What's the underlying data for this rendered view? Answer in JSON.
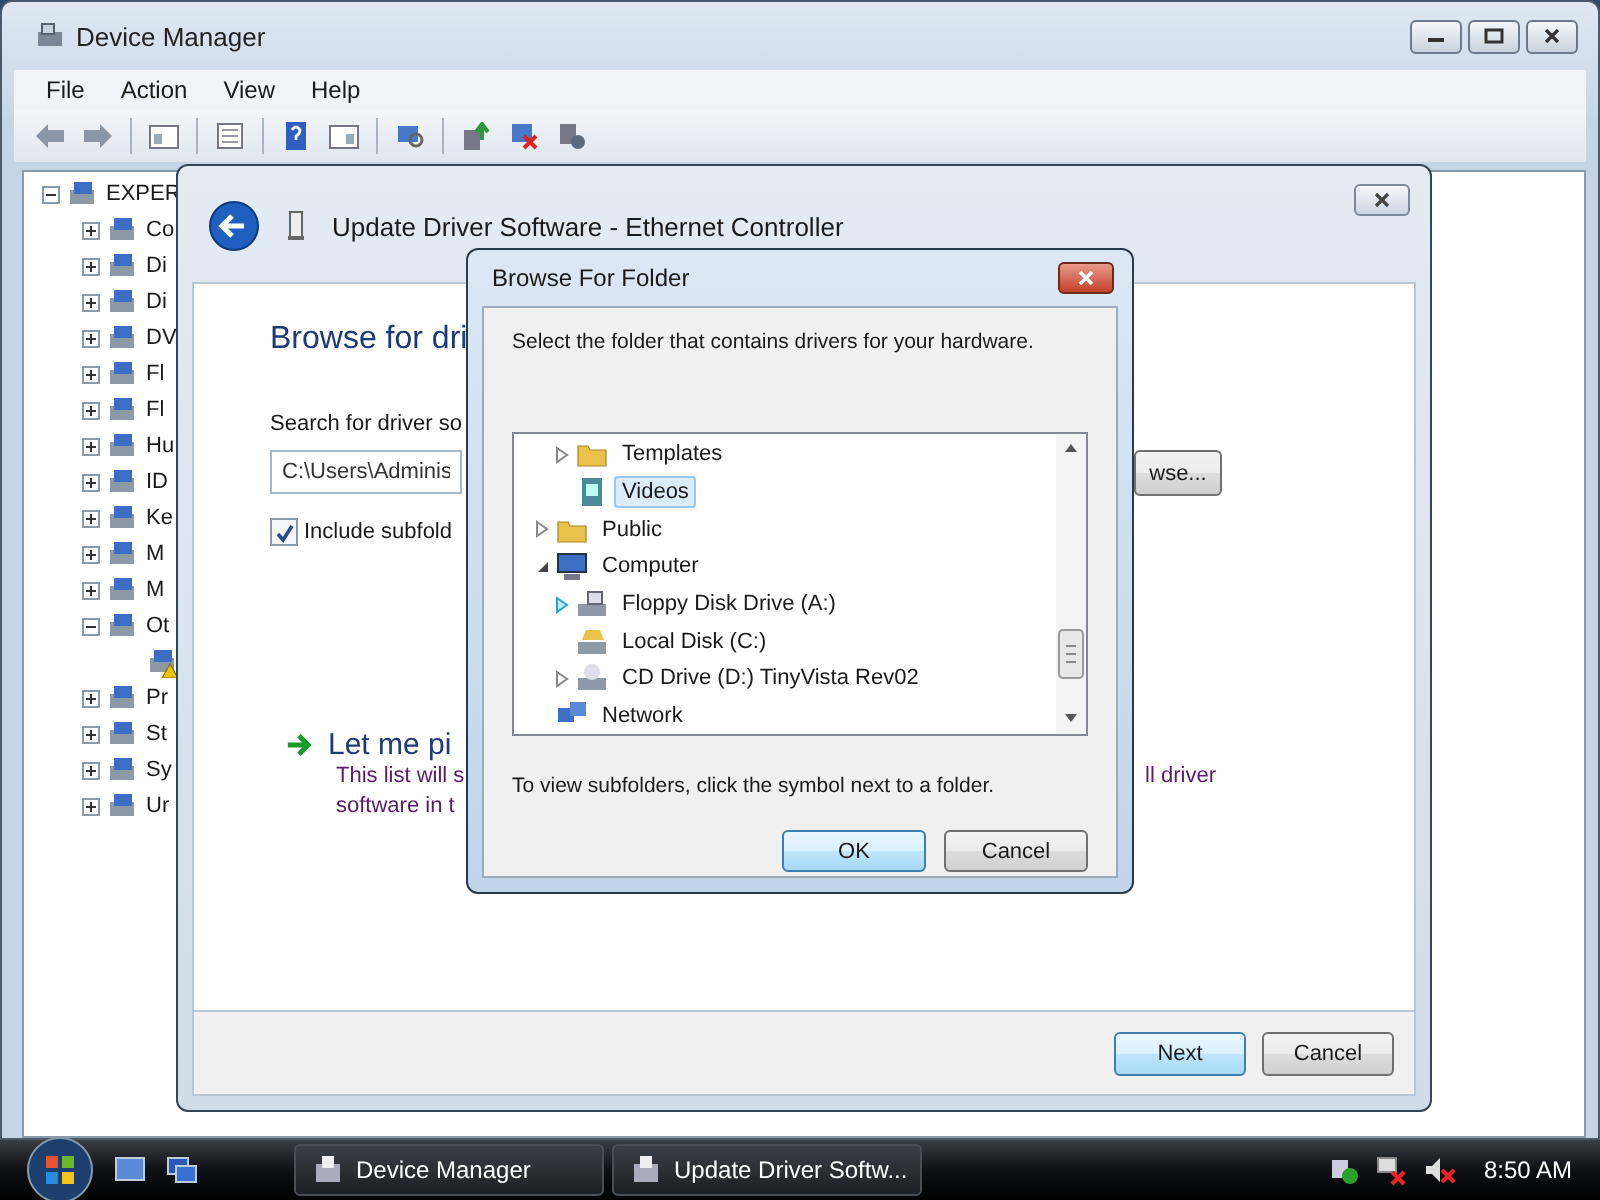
{
  "device_manager": {
    "title": "Device Manager",
    "menu": [
      "File",
      "Action",
      "View",
      "Help"
    ],
    "tree": {
      "label": "EXPER",
      "expanded": true,
      "children": [
        {
          "label": "Co",
          "expanded": false
        },
        {
          "label": "Di",
          "expanded": false
        },
        {
          "label": "Di",
          "expanded": false
        },
        {
          "label": "DV",
          "expanded": false
        },
        {
          "label": "Fl",
          "expanded": false
        },
        {
          "label": "Fl",
          "expanded": false
        },
        {
          "label": "Hu",
          "expanded": false
        },
        {
          "label": "ID",
          "expanded": false
        },
        {
          "label": "Ke",
          "expanded": false
        },
        {
          "label": "M",
          "expanded": false
        },
        {
          "label": "M",
          "expanded": false
        },
        {
          "label": "Ot",
          "expanded": true,
          "children": [
            {
              "warning": true
            }
          ]
        },
        {
          "label": "Pr",
          "expanded": false
        },
        {
          "label": "St",
          "expanded": false
        },
        {
          "label": "Sy",
          "expanded": false
        },
        {
          "label": "Ur",
          "expanded": false
        }
      ]
    }
  },
  "wizard": {
    "title": "Update Driver Software - Ethernet Controller",
    "heading": "Browse for dri",
    "search_label": "Search for driver so",
    "path_value": "C:\\Users\\Adminis",
    "browse_button": "wse...",
    "include_subfolders": {
      "label": "Include subfold",
      "checked": true
    },
    "option": {
      "title": "Let me pi",
      "description_lines": [
        "This list will s",
        "software in t"
      ],
      "description_right": "ll driver"
    },
    "buttons": [
      {
        "label": "Next",
        "default": true
      },
      {
        "label": "Cancel",
        "default": false
      }
    ]
  },
  "browse_dialog": {
    "title": "Browse For Folder",
    "instruction": "Select the folder that contains drivers for your hardware.",
    "tree": [
      {
        "children": [
          {
            "label": "Templates",
            "kind": "folder",
            "arrow": true,
            "expanded": false,
            "hot": false,
            "selected": false
          },
          {
            "label": "Videos",
            "kind": "video-folder",
            "arrow": false,
            "selected": true
          }
        ]
      },
      {
        "label": "Public",
        "kind": "folder",
        "arrow": true,
        "expanded": false,
        "hot": false,
        "selected": false
      },
      {
        "label": "Computer",
        "kind": "computer",
        "arrow": true,
        "expanded": true,
        "hot": false,
        "selected": false,
        "children": [
          {
            "label": "Floppy Disk Drive (A:)",
            "kind": "floppy",
            "arrow": true,
            "expanded": false,
            "hot": true,
            "selected": false
          },
          {
            "label": "Local Disk (C:)",
            "kind": "disk",
            "arrow": false,
            "selected": false
          },
          {
            "label": "CD Drive (D:) TinyVista Rev02",
            "kind": "cd-drive",
            "arrow": true,
            "expanded": false,
            "hot": false,
            "selected": false
          }
        ]
      },
      {
        "label": "Network",
        "kind": "network",
        "arrow": false,
        "selected": false
      }
    ],
    "hint": "To view subfolders, click the symbol next to a folder.",
    "buttons": [
      {
        "label": "OK",
        "default": true
      },
      {
        "label": "Cancel",
        "default": false
      }
    ]
  },
  "taskbar": {
    "tasks": [
      {
        "label": "Device Manager",
        "selected": false
      },
      {
        "label": "Update Driver Softw...",
        "selected": false
      }
    ],
    "clock": "8:50 AM"
  }
}
